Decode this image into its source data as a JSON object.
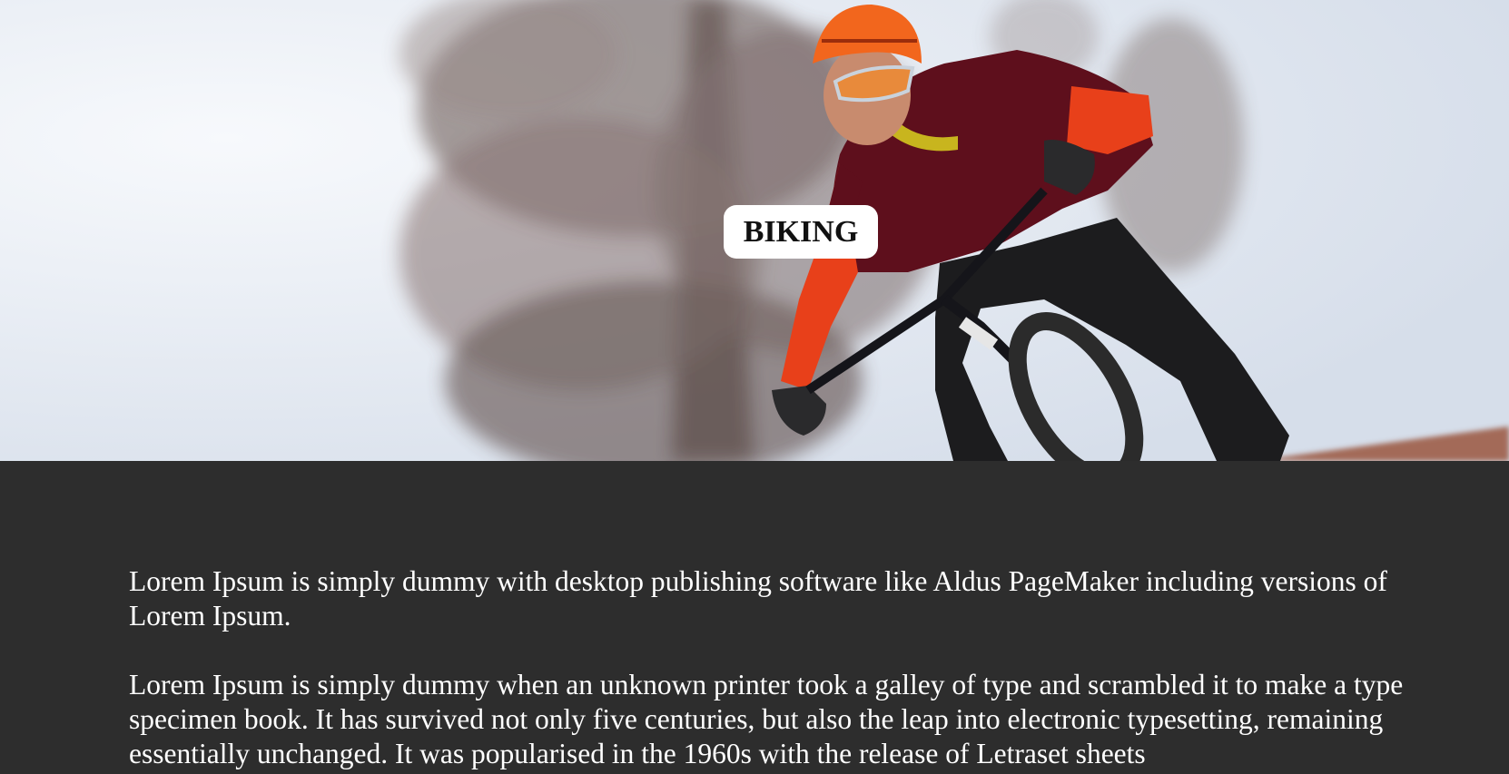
{
  "hero": {
    "image_description_icon": "mountain-biker-photo",
    "title": "BIKING"
  },
  "content": {
    "paragraphs": [
      "Lorem Ipsum is simply dummy with desktop publishing software like Aldus PageMaker including versions of Lorem Ipsum.",
      "Lorem Ipsum is simply dummy when an unknown printer took a galley of type and scrambled it to make a type specimen book. It has survived not only five centuries, but also the leap into electronic typesetting, remaining essentially unchanged. It was popularised in the 1960s with the release of Letraset sheets"
    ]
  },
  "colors": {
    "page_background": "#2d2d2d",
    "text": "#ffffff",
    "badge_background": "#ffffff",
    "badge_text": "#111111"
  }
}
